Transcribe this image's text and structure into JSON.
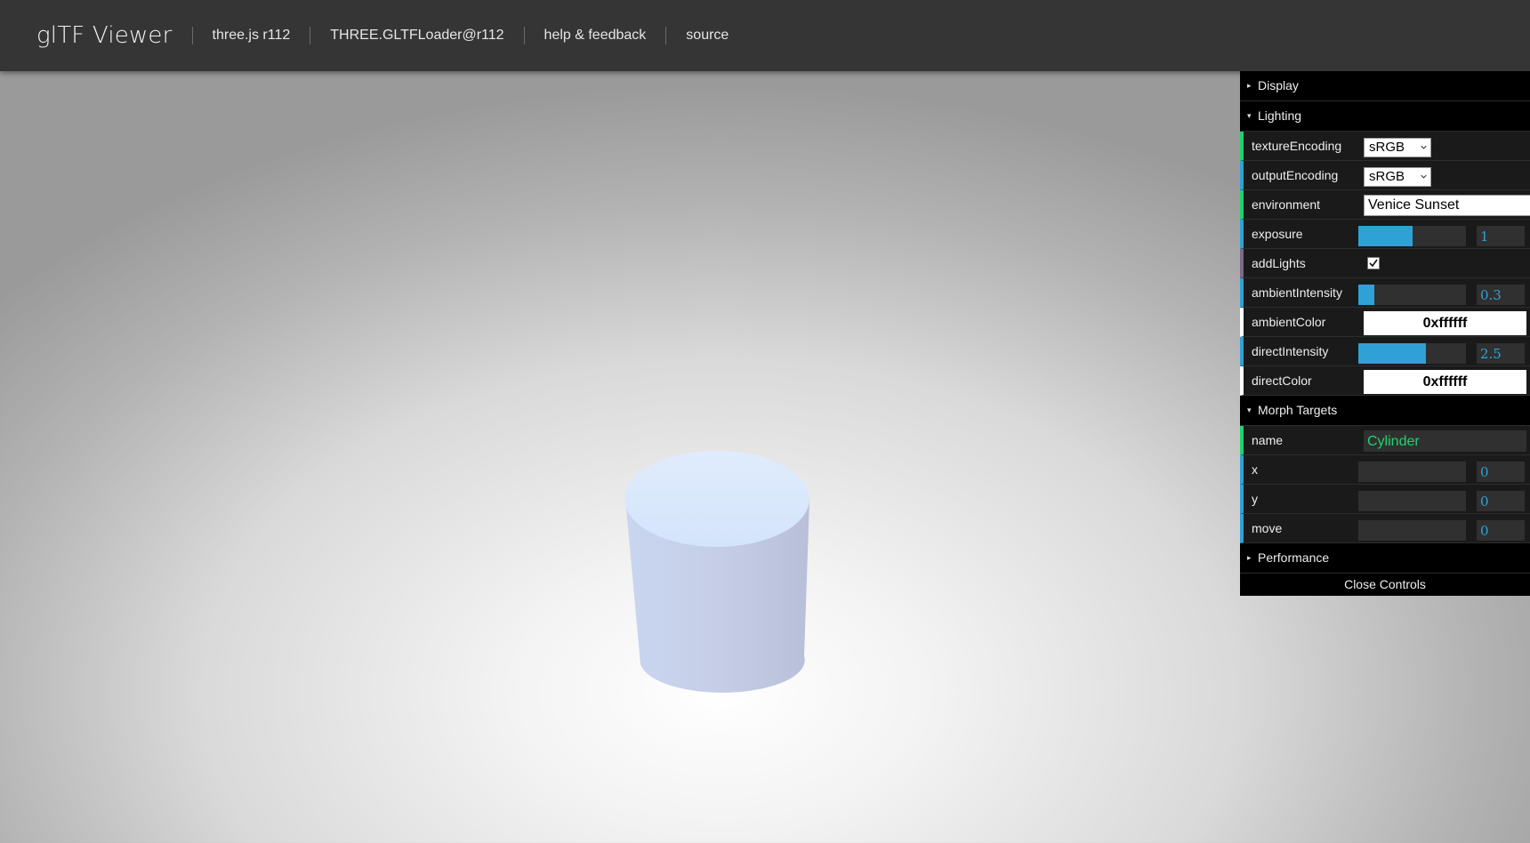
{
  "header": {
    "brand": "glTF Viewer",
    "links": [
      "three.js r112",
      "THREE.GLTFLoader@r112",
      "help & feedback",
      "source"
    ]
  },
  "gui": {
    "display_title": "Display",
    "lighting": {
      "title": "Lighting",
      "textureEncoding": {
        "label": "textureEncoding",
        "value": "sRGB"
      },
      "outputEncoding": {
        "label": "outputEncoding",
        "value": "sRGB"
      },
      "environment": {
        "label": "environment",
        "value": "Venice Sunset"
      },
      "exposure": {
        "label": "exposure",
        "value": "1",
        "fraction": 0.5
      },
      "addLights": {
        "label": "addLights",
        "checked": true
      },
      "ambientIntensity": {
        "label": "ambientIntensity",
        "value": "0.3",
        "fraction": 0.15
      },
      "ambientColor": {
        "label": "ambientColor",
        "value": "0xffffff",
        "color": "#ffffff"
      },
      "directIntensity": {
        "label": "directIntensity",
        "value": "2.5",
        "fraction": 0.625
      },
      "directColor": {
        "label": "directColor",
        "value": "0xffffff",
        "color": "#ffffff"
      }
    },
    "morph": {
      "title": "Morph Targets",
      "name": {
        "label": "name",
        "value": "Cylinder"
      },
      "x": {
        "label": "x",
        "value": "0",
        "fraction": 0
      },
      "y": {
        "label": "y",
        "value": "0",
        "fraction": 0
      },
      "move": {
        "label": "move",
        "value": "0",
        "fraction": 0
      }
    },
    "performance_title": "Performance",
    "close_label": "Close Controls"
  },
  "colors": {
    "header_bg": "#353535",
    "number_accent": "#2fa1d6",
    "string_accent": "#1ed36f",
    "model_top": "#dce9fc",
    "model_side": "#c4cde6"
  }
}
